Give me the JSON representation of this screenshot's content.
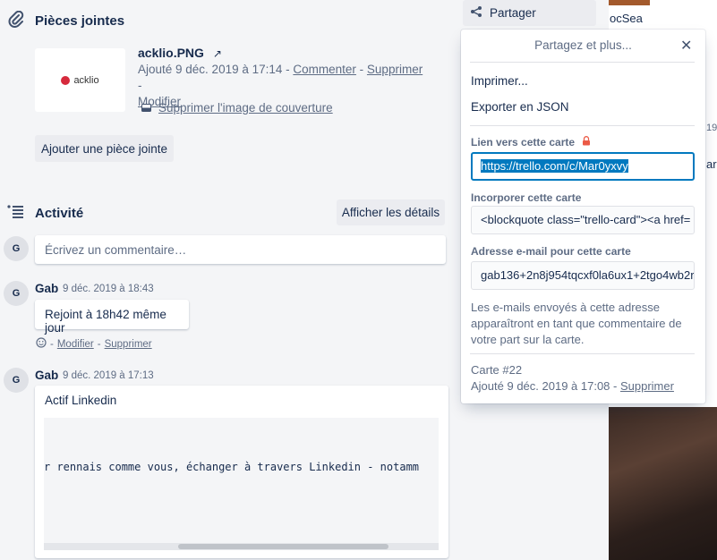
{
  "attachments": {
    "title": "Pièces jointes",
    "file_name": "acklio.PNG",
    "open_glyph": "↗",
    "thumb_logo_text": "acklio",
    "added_text": "Ajouté 9 déc. 2019 à 17:14 - ",
    "comment_link": "Commenter",
    "sep": " - ",
    "delete_link": "Supprimer",
    "sep2": " -",
    "edit_link": "Modifier",
    "remove_cover_link": "Supprimer l'image de couverture",
    "add_button": "Ajouter une pièce jointe"
  },
  "activity": {
    "title": "Activité",
    "details_button": "Afficher les détails",
    "comment_placeholder": "Écrivez un commentaire…",
    "avatar_initial": "G",
    "comments": [
      {
        "author": "Gab",
        "timestamp": "9 déc. 2019 à 18:43",
        "text": "Rejoint à 18h42 même jour",
        "actions_sep": " - ",
        "edit": "Modifier",
        "actions_sep2": " - ",
        "delete": "Supprimer"
      },
      {
        "author": "Gab",
        "timestamp": "9 déc. 2019 à 17:13",
        "text": "Actif Linkedin",
        "code": "r rennais comme vous, échanger à travers Linkedin - notamm"
      }
    ]
  },
  "share_button": {
    "label": "Partager"
  },
  "popover": {
    "title": "Partagez et plus...",
    "print": "Imprimer...",
    "export_json": "Exporter en JSON",
    "link_label": "Lien vers cette carte",
    "link_value": "https://trello.com/c/Mar0yxvy",
    "embed_label": "Incorporer cette carte",
    "embed_value": "<blockquote class=\"trello-card\"><a href=",
    "email_label": "Adresse e-mail pour cette carte",
    "email_value": "gab136+2n8j954tqcxf0la6ux1+2tgo4wb2r",
    "email_note": "Les e-mails envoyés à cette adresse apparaîtront en tant que commentaire de votre part sur la carte.",
    "card_number": "Carte #22",
    "card_added": "Ajouté 9 déc. 2019 à 17:08 - ",
    "card_delete": "Supprimer"
  },
  "background_peek": {
    "top_label": "ocSea",
    "number_peek": "19",
    "letters_peek": "ar"
  },
  "colors": {
    "accent_blue": "#0079bf",
    "lock_red": "#eb5a46",
    "panel_bg": "#f4f5f7"
  }
}
